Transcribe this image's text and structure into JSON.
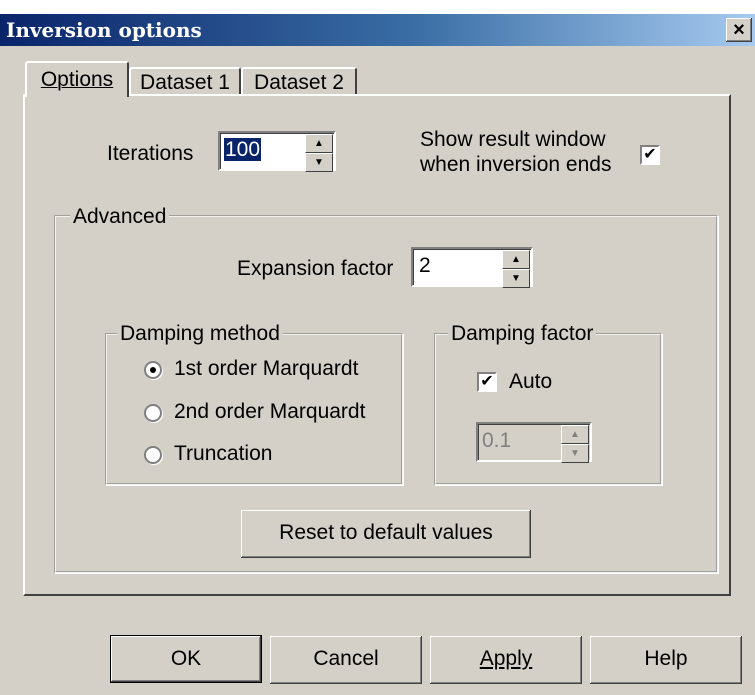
{
  "background_text": "",
  "window": {
    "title": "Inversion options",
    "close_glyph": "×"
  },
  "tabs": [
    {
      "label": "Options",
      "active": true
    },
    {
      "label": "Dataset 1",
      "active": false
    },
    {
      "label": "Dataset 2",
      "active": false
    }
  ],
  "options": {
    "iterations_label": "Iterations",
    "iterations_value": "100",
    "show_result_line1": "Show result window",
    "show_result_line2": "when inversion ends",
    "show_result_checked": true
  },
  "advanced": {
    "title": "Advanced",
    "expansion_label": "Expansion factor",
    "expansion_value": "2",
    "damping_method": {
      "title": "Damping method",
      "options": [
        {
          "label": "1st order Marquardt",
          "selected": true
        },
        {
          "label": "2nd order Marquardt",
          "selected": false
        },
        {
          "label": "Truncation",
          "selected": false
        }
      ]
    },
    "damping_factor": {
      "title": "Damping factor",
      "auto_label": "Auto",
      "auto_checked": true,
      "value": "0.1"
    },
    "reset_label": "Reset to default values"
  },
  "buttons": {
    "ok": "OK",
    "cancel": "Cancel",
    "apply": "Apply",
    "help": "Help"
  },
  "glyphs": {
    "check": "✔",
    "up": "▲",
    "down": "▼"
  },
  "colors": {
    "face": "#d4d0c8",
    "title_start": "#0a246a",
    "title_end": "#a6caf0",
    "bg_text": "#1a8a1a"
  }
}
